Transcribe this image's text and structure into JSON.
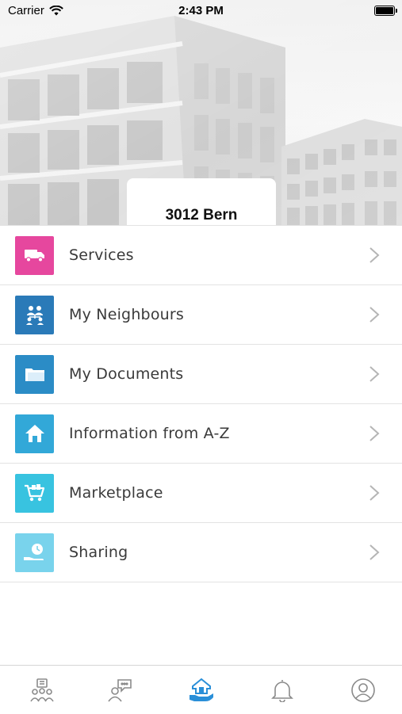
{
  "status_bar": {
    "carrier": "Carrier",
    "time": "2:43 PM"
  },
  "header": {
    "location": "3012 Bern"
  },
  "menu": {
    "items": [
      {
        "label": "Services",
        "icon": "delivery-truck-icon",
        "color": "#e6479e"
      },
      {
        "label": "My Neighbours",
        "icon": "neighbours-icon",
        "color": "#2a7ab8"
      },
      {
        "label": "My Documents",
        "icon": "folder-icon",
        "color": "#2b8cc6"
      },
      {
        "label": "Information from A-Z",
        "icon": "house-icon",
        "color": "#32a8d8"
      },
      {
        "label": "Marketplace",
        "icon": "shopping-cart-icon",
        "color": "#38c3e0"
      },
      {
        "label": "Sharing",
        "icon": "sharing-hand-icon",
        "color": "#79d3ec"
      }
    ]
  },
  "tab_bar": {
    "tabs": [
      {
        "icon": "community-icon",
        "active": false
      },
      {
        "icon": "chat-person-icon",
        "active": false
      },
      {
        "icon": "home-hand-icon",
        "active": true
      },
      {
        "icon": "bell-icon",
        "active": false
      },
      {
        "icon": "profile-icon",
        "active": false
      }
    ],
    "active_color": "#2a8fd8",
    "inactive_color": "#8a8a8a"
  }
}
